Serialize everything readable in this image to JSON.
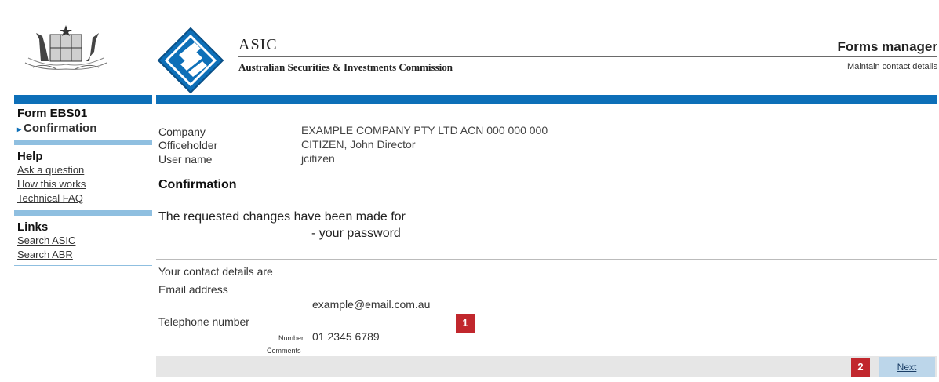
{
  "header": {
    "agency_short": "ASIC",
    "agency_full": "Australian Securities & Investments Commission",
    "app_title": "Forms manager",
    "app_subtitle": "Maintain contact details"
  },
  "sidebar": {
    "form_title": "Form EBS01",
    "current_step": "Confirmation",
    "help_heading": "Help",
    "help_links": [
      "Ask a question",
      "How this works",
      "Technical FAQ"
    ],
    "links_heading": "Links",
    "links": [
      "Search ASIC",
      "Search ABR"
    ]
  },
  "details": {
    "company_label": "Company",
    "company_value": "EXAMPLE COMPANY PTY LTD ACN 000 000 000",
    "officeholder_label": "Officeholder",
    "officeholder_value": "CITIZEN, John Director",
    "username_label": "User name",
    "username_value": "jcitizen"
  },
  "confirmation": {
    "heading": "Confirmation",
    "message_line1": "The requested changes have been made for",
    "message_line2": "- your password"
  },
  "contact": {
    "intro": "Your contact details are",
    "email_label": "Email address",
    "email_value": "example@email.com.au",
    "phone_label": "Telephone number",
    "number_label": "Number",
    "number_value": "01 2345 6789",
    "comments_label": "Comments"
  },
  "annotations": {
    "badge1": "1",
    "badge2": "2"
  },
  "footer": {
    "next_label": "Next"
  },
  "colors": {
    "brand_blue": "#0d6fb8",
    "light_blue": "#8fbfe0",
    "badge_red": "#c1272d",
    "button_bg": "#bcd6ea"
  },
  "icons": {
    "crest": "coat-of-arms-icon",
    "logo": "asic-diamond-logo-icon"
  }
}
